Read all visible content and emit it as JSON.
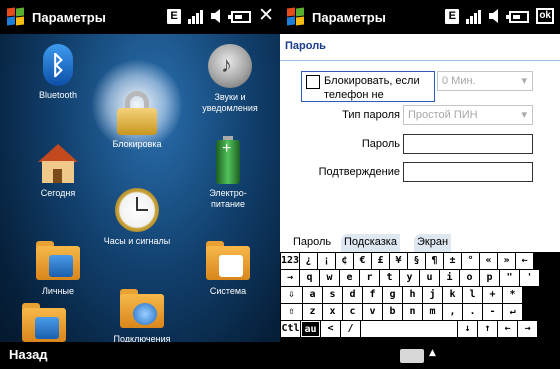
{
  "left": {
    "title": "Параметры",
    "status": {
      "e_badge": "E",
      "close": "✕"
    },
    "apps": [
      {
        "label": "Bluetooth",
        "icon": "bluetooth-icon"
      },
      {
        "label": "Звуки и уведомления",
        "icon": "sound-icon"
      },
      {
        "label": "Блокировка",
        "icon": "lock-icon"
      },
      {
        "label": "Сегодня",
        "icon": "home-icon"
      },
      {
        "label": "Электро-питание",
        "icon": "battery-icon"
      },
      {
        "label": "Часы и сигналы",
        "icon": "clock-icon"
      },
      {
        "label": "Личные",
        "icon": "personal-folder-icon"
      },
      {
        "label": "Система",
        "icon": "system-folder-icon"
      },
      {
        "label": "Подключения",
        "icon": "connections-folder-icon"
      }
    ],
    "back": "Назад"
  },
  "right": {
    "title": "Параметры",
    "status": {
      "e_badge": "E",
      "ok": "ok"
    },
    "section_title": "Пароль",
    "form": {
      "lock_checkbox_label": "Блокировать, если телефон не",
      "lock_checked": false,
      "lock_time_value": "0 Мин.",
      "password_type_label": "Тип пароля",
      "password_type_value": "Простой ПИН",
      "password_label": "Пароль",
      "password_value": "",
      "confirm_label": "Подтверждение",
      "confirm_value": ""
    },
    "tabs": [
      "Пароль",
      "Подсказка",
      "Экран"
    ],
    "keyboard": {
      "rows": [
        [
          "123",
          "¿",
          "¡",
          "¢",
          "€",
          "£",
          "¥",
          "§",
          "¶",
          "±",
          "°",
          "«",
          "»",
          "←"
        ],
        [
          "→",
          "q",
          "w",
          "e",
          "r",
          "t",
          "y",
          "u",
          "i",
          "o",
          "p",
          "\"",
          "'"
        ],
        [
          "⇩",
          "a",
          "s",
          "d",
          "f",
          "g",
          "h",
          "j",
          "k",
          "l",
          "+",
          "*"
        ],
        [
          "⇧",
          "z",
          "x",
          "c",
          "v",
          "b",
          "n",
          "m",
          ",",
          ".",
          "-",
          "↵"
        ],
        [
          "Ctl",
          "au",
          "<",
          "/",
          "",
          "↓",
          "↑",
          "←",
          "→"
        ]
      ]
    }
  },
  "colors": {
    "title_blue": "#1a3c8c",
    "focus_border": "#2e5bb8",
    "left_background": "#113f6c"
  }
}
